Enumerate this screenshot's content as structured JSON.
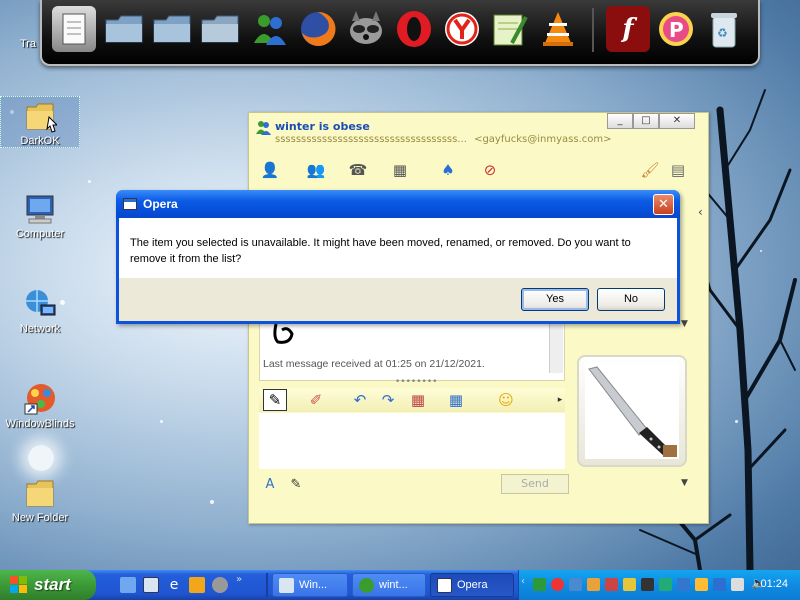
{
  "desktop": {
    "icons": [
      {
        "label": "Tra"
      },
      {
        "label": "DarkOK"
      },
      {
        "label": "Computer"
      },
      {
        "label": "Network"
      },
      {
        "label": "WindowBlinds"
      },
      {
        "label": "New Folder"
      }
    ]
  },
  "dock": {
    "icons": [
      "notepad-icon",
      "folder-icon",
      "folder-icon",
      "folder-icon",
      "msn-messenger-icon",
      "firefox-icon",
      "raccoon-icon",
      "opera-icon",
      "yandex-icon",
      "notepad-pen-icon",
      "vlc-icon",
      "flash-icon",
      "picasa-icon",
      "recycle-bin-icon"
    ]
  },
  "messenger": {
    "title": "winter is obese",
    "subtitle_status": "sssssssssssssssssssssssssssssssssss...",
    "subtitle_email": "<gayfucks@inmyass.com>",
    "last_message": "Last message received at 01:25 on 21/12/2021.",
    "send_label": "Send",
    "bg_color": "#fbfac7"
  },
  "dialog": {
    "title": "Opera",
    "message": "The item you selected is unavailable.  It might have been moved, renamed, or removed.  Do you want to remove it from the list?",
    "yes_label": "Yes",
    "no_label": "No",
    "close_label": "✕"
  },
  "taskbar": {
    "start_label": "start",
    "tasks": [
      {
        "label": "Win..."
      },
      {
        "label": "wint..."
      },
      {
        "label": "Opera"
      }
    ],
    "clock": "01:24",
    "accent": "#245edb"
  }
}
